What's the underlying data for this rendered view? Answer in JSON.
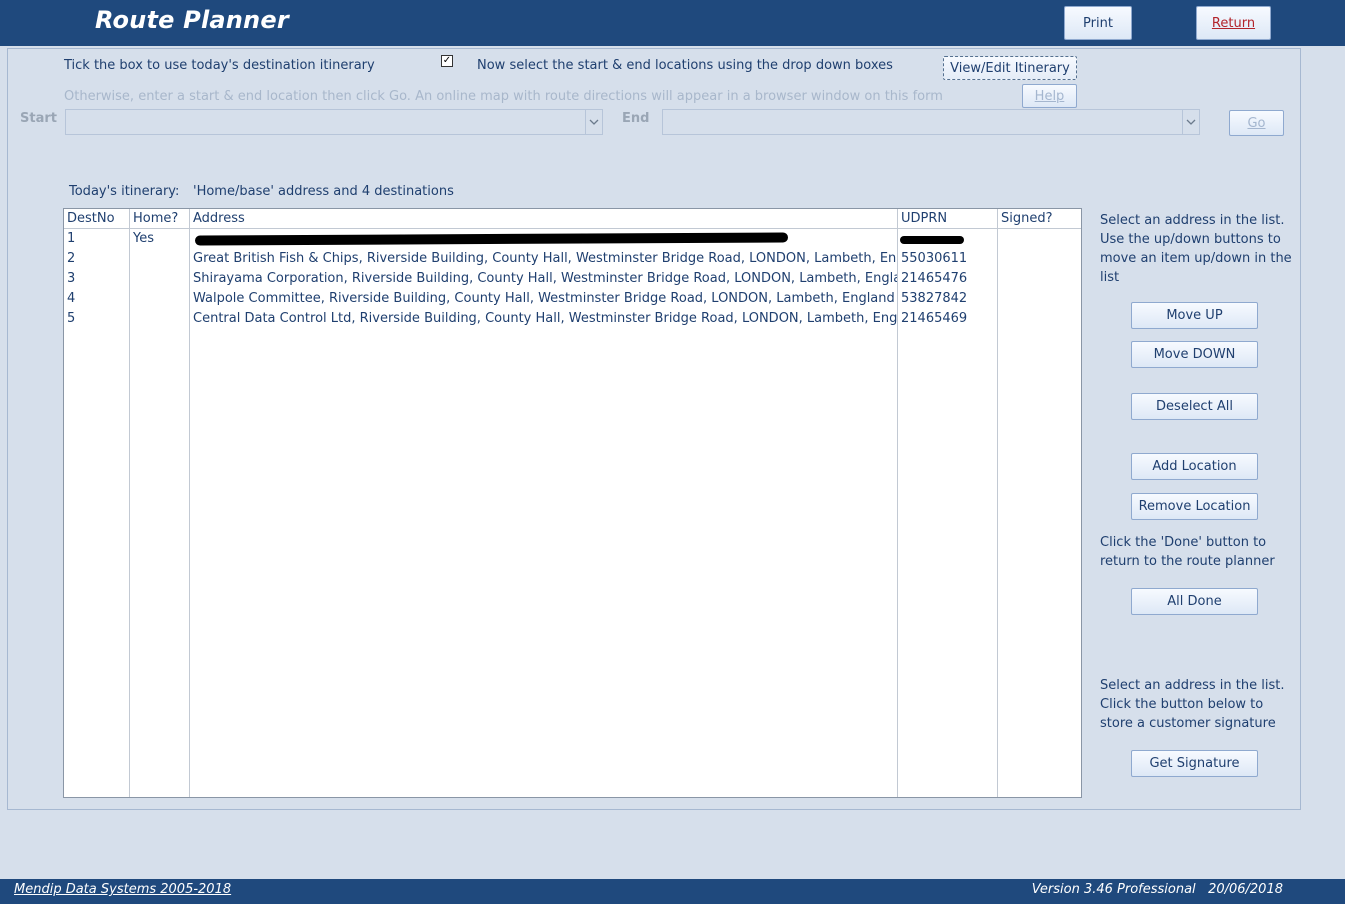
{
  "header": {
    "title": "Route Planner",
    "print_label": "Print",
    "return_label": "Return"
  },
  "instructions": {
    "tick_text": "Tick the box to use today's destination itinerary",
    "checkbox_checked": true,
    "select_text": "Now select the start & end locations using the drop down boxes",
    "view_edit_label": "View/Edit Itinerary",
    "otherwise_text": "Otherwise, enter a start & end location then click Go.   An online map with route directions will appear in a browser window on this form",
    "help_label": "Help"
  },
  "route": {
    "start_label": "Start",
    "end_label": "End",
    "start_value": "",
    "end_value": "",
    "go_label": "Go"
  },
  "itinerary": {
    "summary_label": "Today's itinerary:",
    "summary_value": "'Home/base' address and 4 destinations",
    "columns": [
      "DestNo",
      "Home?",
      "Address",
      "UDPRN",
      "Signed?"
    ],
    "rows": [
      {
        "destno": "1",
        "home": "Yes",
        "address": "",
        "udprn": "",
        "signed": ""
      },
      {
        "destno": "2",
        "home": "",
        "address": "Great British Fish & Chips, Riverside Building, County Hall, Westminster Bridge Road, LONDON, Lambeth, En",
        "udprn": "55030611",
        "signed": ""
      },
      {
        "destno": "3",
        "home": "",
        "address": "Shirayama Corporation, Riverside Building, County Hall, Westminster Bridge Road, LONDON, Lambeth, Engla",
        "udprn": "21465476",
        "signed": ""
      },
      {
        "destno": "4",
        "home": "",
        "address": "Walpole Committee, Riverside Building, County Hall, Westminster Bridge Road, LONDON, Lambeth, England",
        "udprn": "53827842",
        "signed": ""
      },
      {
        "destno": "5",
        "home": "",
        "address": "Central Data Control Ltd, Riverside Building, County Hall, Westminster Bridge Road, LONDON, Lambeth, Eng",
        "udprn": "21465469",
        "signed": ""
      }
    ]
  },
  "side": {
    "move_instructions": "Select an address in the list. Use the up/down buttons to move an item up/down in the list",
    "move_up_label": "Move UP",
    "move_down_label": "Move DOWN",
    "deselect_label": "Deselect All",
    "add_label": "Add Location",
    "remove_label": "Remove Location",
    "done_instructions": "Click the 'Done' button to return to the route planner",
    "all_done_label": "All Done",
    "signature_instructions": "Select an address in the list. Click the button below to store a customer signature",
    "signature_label": "Get Signature"
  },
  "footer": {
    "company": "Mendip Data Systems 2005-2018",
    "version": "Version 3.46 Professional   20/06/2018"
  }
}
